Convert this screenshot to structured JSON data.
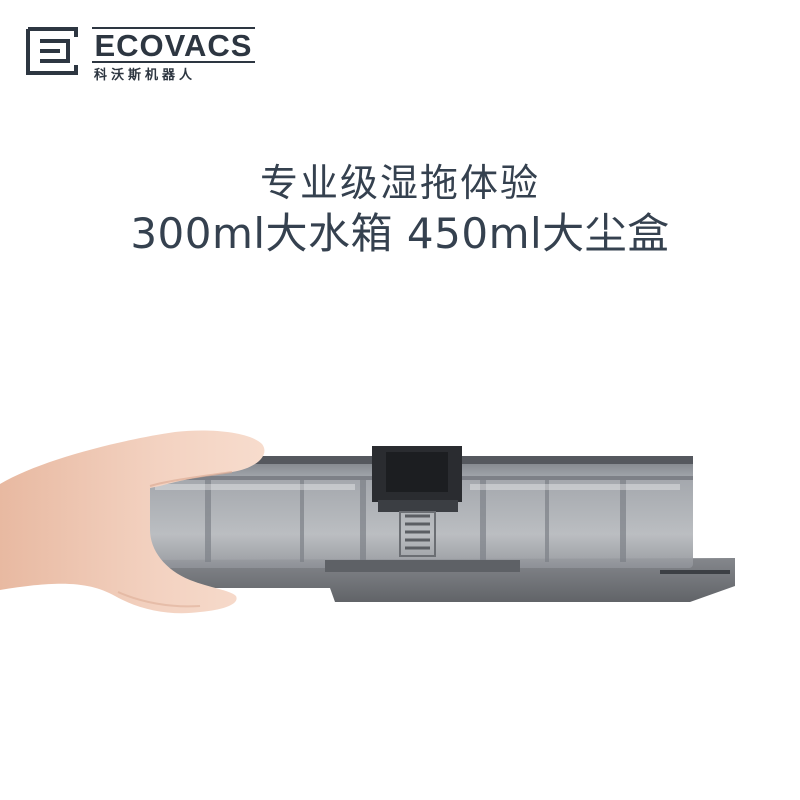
{
  "brand": {
    "name": "ECOVACS",
    "subtitle": "科沃斯机器人",
    "logo_icon": "ecovacs-e-mark-icon"
  },
  "headline": {
    "line1": "专业级湿拖体验",
    "line2": "300ml大水箱 450ml大尘盒"
  },
  "image": {
    "subject": "hand-holding-water-tank-photo",
    "colors": {
      "tank_body": "#8a8e94",
      "tank_edge": "#3a3d42",
      "skin": "#f2cdb8",
      "text": "#35414f",
      "logo": "#2d3641"
    }
  }
}
